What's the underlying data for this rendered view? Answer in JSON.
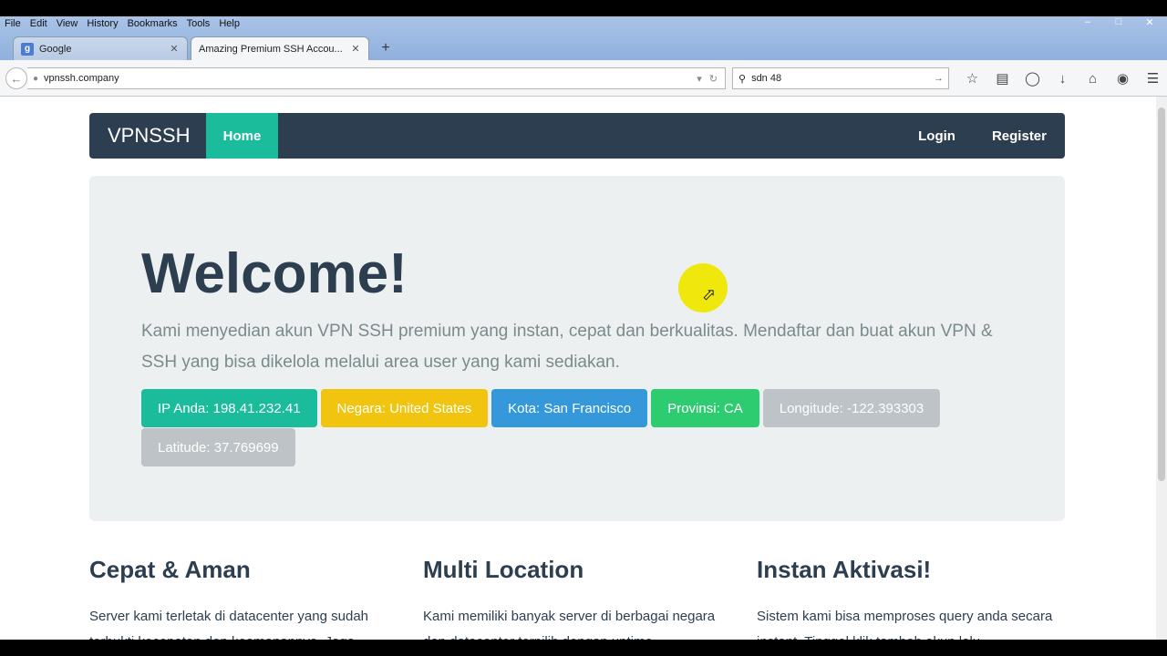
{
  "browser": {
    "menu": [
      "File",
      "Edit",
      "View",
      "History",
      "Bookmarks",
      "Tools",
      "Help"
    ],
    "tabs": [
      {
        "favicon": "g",
        "title": "Google",
        "active": false
      },
      {
        "favicon": "",
        "title": "Amazing Premium SSH Accou...",
        "active": true
      }
    ],
    "url": "vpnssh.company",
    "search_query": "sdn 48"
  },
  "site": {
    "brand": "VPNSSH",
    "nav": {
      "home": "Home",
      "login": "Login",
      "register": "Register"
    },
    "hero": {
      "title": "Welcome!",
      "text": "Kami menyedian akun VPN SSH premium yang instan, cepat dan berkualitas. Mendaftar dan buat akun VPN & SSH yang bisa dikelola melalui area user yang kami sediakan.",
      "badges": [
        {
          "text": "IP Anda: 198.41.232.41",
          "color": "#1abc9c"
        },
        {
          "text": "Negara: United States",
          "color": "#f1c40f"
        },
        {
          "text": "Kota: San Francisco",
          "color": "#3498db"
        },
        {
          "text": "Provinsi: CA",
          "color": "#2ecc71"
        },
        {
          "text": "Longitude: -122.393303",
          "color": "#bdc3c7"
        },
        {
          "text": "Latitude: 37.769699",
          "color": "#bdc3c7"
        }
      ]
    },
    "features": [
      {
        "title": "Cepat & Aman",
        "text": "Server kami terletak di datacenter yang sudah terbukti kecepatan dan keamanannya. Jaga"
      },
      {
        "title": "Multi Location",
        "text": "Kami memiliki banyak server di berbagai negara dan datacenter terpilih dengan uptime"
      },
      {
        "title": "Instan Aktivasi!",
        "text": "Sistem kami bisa memproses query anda secara instant. Tinggal klik tambah akun lalu"
      }
    ]
  }
}
